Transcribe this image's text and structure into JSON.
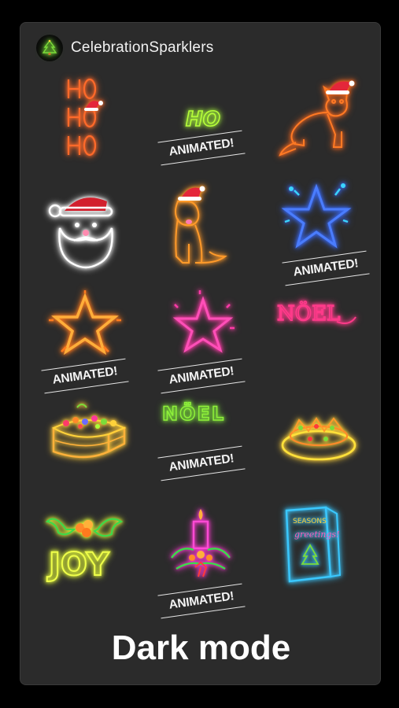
{
  "header": {
    "app_name": "CelebrationSparklers",
    "app_icon": "christmas-tree-icon"
  },
  "stickers": [
    {
      "name": "ho-ho-ho",
      "text": "HO",
      "animated": false
    },
    {
      "name": "ho-animated",
      "text": "HO",
      "animated": true,
      "badge": "ANIMATED!"
    },
    {
      "name": "cat-santa-hat",
      "animated": false
    },
    {
      "name": "santa-face",
      "animated": false
    },
    {
      "name": "dog-santa-hat",
      "animated": false
    },
    {
      "name": "blue-star",
      "animated": true,
      "badge": "ANIMATED!"
    },
    {
      "name": "orange-star",
      "animated": true,
      "badge": "ANIMATED!"
    },
    {
      "name": "pink-star",
      "animated": true,
      "badge": "ANIMATED!"
    },
    {
      "name": "noel-pink",
      "text": "NÖEL",
      "animated": false
    },
    {
      "name": "cake",
      "animated": false
    },
    {
      "name": "noel-green",
      "text": "NÖEL",
      "animated": true,
      "badge": "ANIMATED!"
    },
    {
      "name": "tart-plate",
      "animated": false
    },
    {
      "name": "joy-holly",
      "text": "JOY",
      "animated": false
    },
    {
      "name": "candle-wreath",
      "animated": true,
      "badge": "ANIMATED!"
    },
    {
      "name": "seasons-greetings-card",
      "text1": "SEASONS",
      "text2": "greetings!",
      "animated": false
    }
  ],
  "footer": {
    "label": "Dark mode"
  }
}
